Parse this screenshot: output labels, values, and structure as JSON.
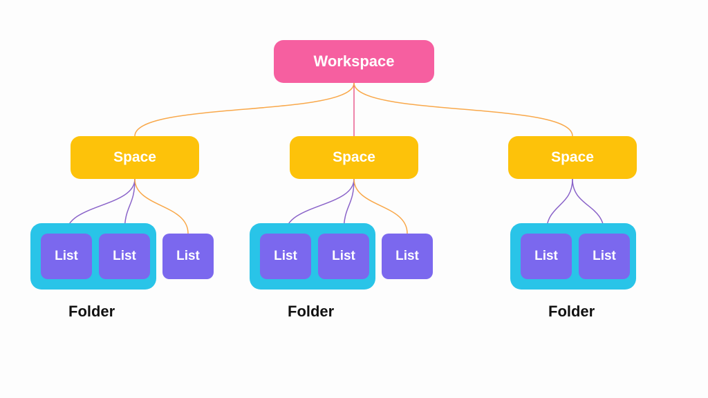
{
  "workspace": {
    "label": "Workspace"
  },
  "spaces": [
    {
      "label": "Space"
    },
    {
      "label": "Space"
    },
    {
      "label": "Space"
    }
  ],
  "folders": [
    {
      "label": "Folder",
      "lists": [
        {
          "label": "List"
        },
        {
          "label": "List"
        }
      ],
      "orphan_list": {
        "label": "List"
      }
    },
    {
      "label": "Folder",
      "lists": [
        {
          "label": "List"
        },
        {
          "label": "List"
        }
      ],
      "orphan_list": {
        "label": "List"
      }
    },
    {
      "label": "Folder",
      "lists": [
        {
          "label": "List"
        },
        {
          "label": "List"
        }
      ]
    }
  ],
  "colors": {
    "workspace": "#f65fa0",
    "space": "#fdc20a",
    "list": "#7b68ee",
    "folder_bg": "#29c4e8"
  }
}
